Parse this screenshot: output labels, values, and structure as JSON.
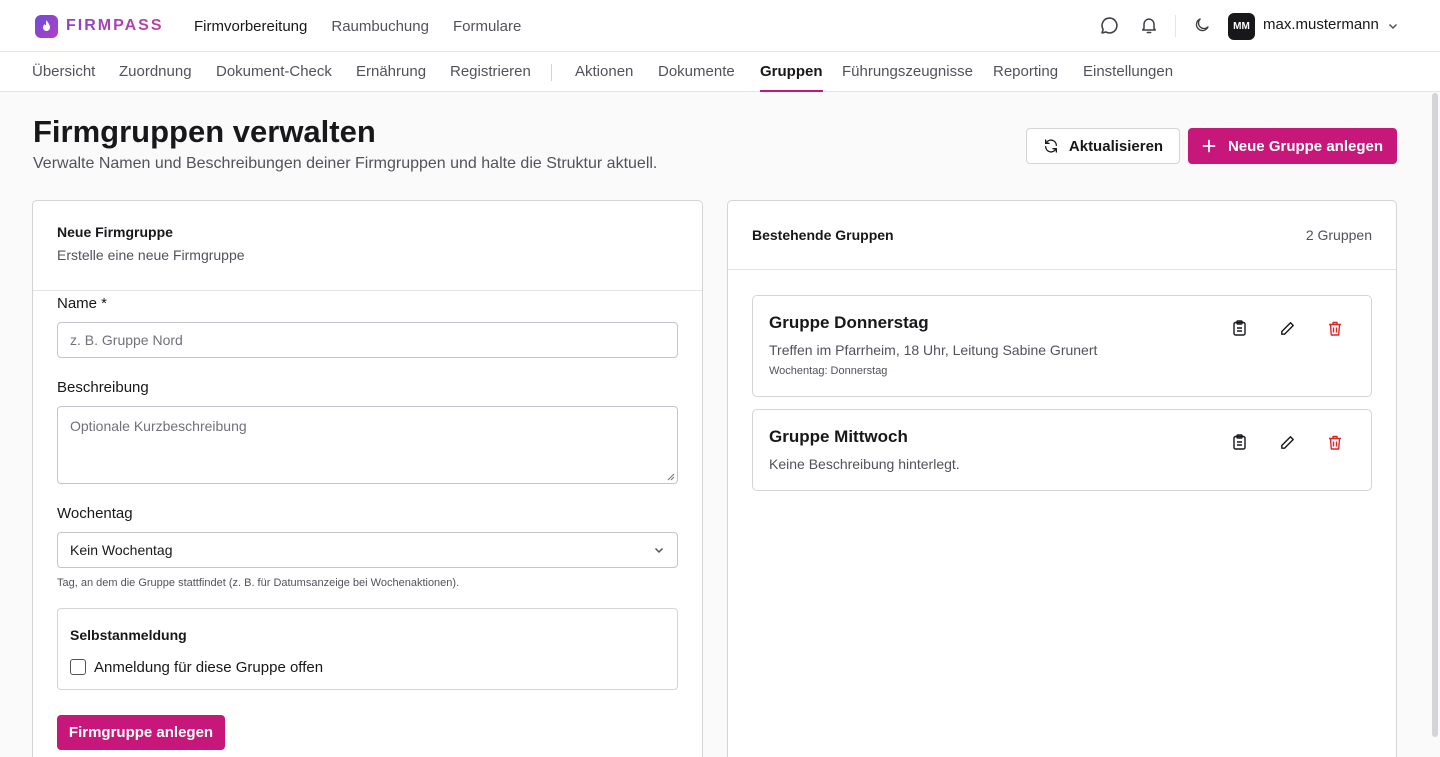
{
  "app": {
    "brand": "FIRMPASS",
    "nav": [
      {
        "label": "Firmvorbereitung",
        "active": true
      },
      {
        "label": "Raumbuchung",
        "active": false
      },
      {
        "label": "Formulare",
        "active": false
      }
    ],
    "user": {
      "initials": "MM",
      "name": "max.mustermann"
    }
  },
  "subnav": {
    "tabs": [
      {
        "label": "Übersicht"
      },
      {
        "label": "Zuordnung"
      },
      {
        "label": "Dokument-Check"
      },
      {
        "label": "Ernährung"
      },
      {
        "label": "Registrieren"
      },
      {
        "label": "Aktionen"
      },
      {
        "label": "Dokumente"
      },
      {
        "label": "Gruppen",
        "active": true
      },
      {
        "label": "Führungszeugnisse"
      },
      {
        "label": "Reporting"
      },
      {
        "label": "Einstellungen"
      }
    ]
  },
  "page": {
    "title": "Firmgruppen verwalten",
    "subtitle": "Verwalte Namen und Beschreibungen deiner Firmgruppen und halte die Struktur aktuell.",
    "refresh_label": "Aktualisieren",
    "new_group_label": "Neue Gruppe anlegen"
  },
  "form": {
    "title": "Neue Firmgruppe",
    "description": "Erstelle eine neue Firmgruppe",
    "name_label": "Name *",
    "name_placeholder": "z. B. Gruppe Nord",
    "desc_label": "Beschreibung",
    "desc_placeholder": "Optionale Kurzbeschreibung",
    "weekday_label": "Wochentag",
    "weekday_value": "Kein Wochentag",
    "weekday_hint": "Tag, an dem die Gruppe stattfindet (z. B. für Datumsanzeige bei Wochenaktionen).",
    "self_signup_title": "Selbstanmeldung",
    "self_signup_checkbox": "Anmeldung für diese Gruppe offen",
    "self_signup_checked": false,
    "submit_label": "Firmgruppe anlegen"
  },
  "groups": {
    "title": "Bestehende Gruppen",
    "count": "2 Gruppen",
    "items": [
      {
        "name": "Gruppe Donnerstag",
        "description": "Treffen im Pfarrheim, 18 Uhr, Leitung Sabine Grunert",
        "meta": "Wochentag: Donnerstag"
      },
      {
        "name": "Gruppe Mittwoch",
        "description": "Keine Beschreibung hinterlegt."
      }
    ]
  },
  "colors": {
    "accent": "#c7177a",
    "danger": "#dc2626",
    "text": "#18181b",
    "muted": "#52525b",
    "border": "#d4d4d8"
  },
  "icons": [
    "chat-icon",
    "bell-icon",
    "moon-icon",
    "chevron-down-icon",
    "refresh-icon",
    "plus-icon",
    "clipboard-icon",
    "pencil-icon",
    "trash-icon"
  ]
}
